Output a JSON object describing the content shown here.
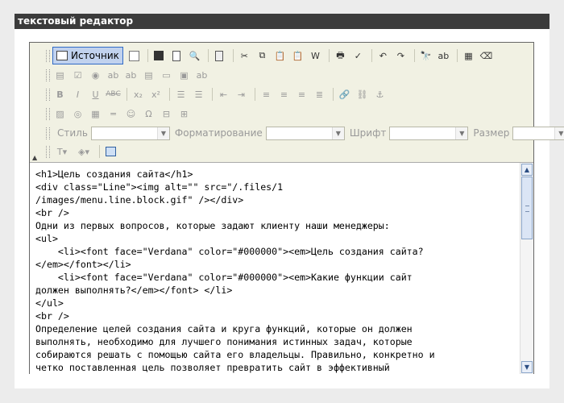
{
  "title": "текстовый редактор",
  "toolbar": {
    "source_label": "Источник",
    "style_label": "Стиль",
    "format_label": "Форматирование",
    "font_label": "Шрифт",
    "size_label": "Размер",
    "style_value": "",
    "format_value": "",
    "font_value": "",
    "size_value": ""
  },
  "code_lines": [
    "<h1>Цель создания сайта</h1>",
    "<div class=\"Line\"><img alt=\"\" src=\"/.files/1",
    "/images/menu.line.block.gif\" /></div>",
    "<br />",
    "Одни из первых вопросов, которые задают клиенту наши менеджеры:",
    "<ul>",
    "    <li><font face=\"Verdana\" color=\"#000000\"><em>Цель создания сайта?",
    "</em></font></li>",
    "    <li><font face=\"Verdana\" color=\"#000000\"><em>Какие функции сайт",
    "должен выполнять?</em></font> </li>",
    "</ul>",
    "<br />",
    "Определение целей создания сайта и круга функций, которые он должен",
    "выполнять, необходимо для лучшего понимания истинных задач, которые",
    "собираются решать с помощью сайта его владельцы. Правильно, конкретно и",
    "четко поставленная цель позволяет превратить сайт в эффективный"
  ]
}
